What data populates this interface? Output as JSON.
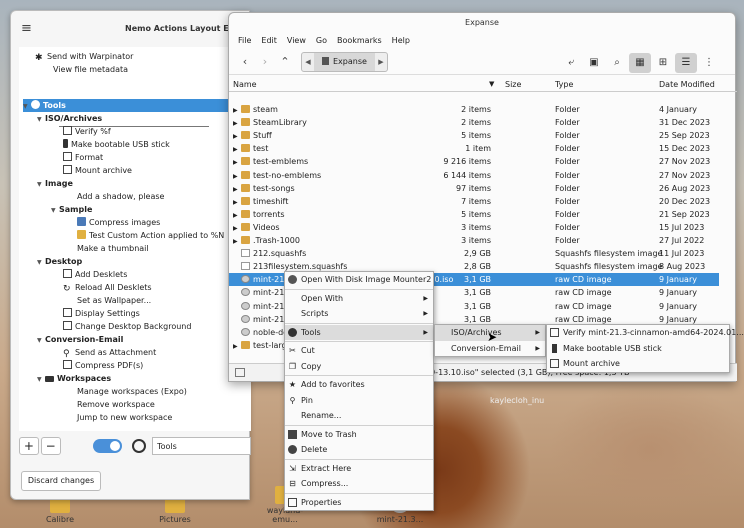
{
  "desktop": {
    "icons": [
      "Calibre",
      "Pictures",
      "wayland-emu...",
      "mint-21.3..."
    ],
    "watermark": "kaylecloh_inu"
  },
  "editor": {
    "title": "Nemo Actions Layout E",
    "items": [
      {
        "label": "Send with Warpinator"
      },
      {
        "label": "View file metadata"
      },
      {
        "label": "Tools"
      },
      {
        "label": "ISO/Archives"
      },
      {
        "label": "Verify %f"
      },
      {
        "label": "Make bootable USB stick"
      },
      {
        "label": "Format"
      },
      {
        "label": "Mount archive"
      },
      {
        "label": "Image"
      },
      {
        "label": "Add a shadow, please"
      },
      {
        "label": "Sample"
      },
      {
        "label": "Compress images"
      },
      {
        "label": "Test Custom Action applied to %N"
      },
      {
        "label": "Make a thumbnail"
      },
      {
        "label": "Desktop"
      },
      {
        "label": "Add Desklets"
      },
      {
        "label": "Reload All Desklets"
      },
      {
        "label": "Set as Wallpaper..."
      },
      {
        "label": "Display Settings"
      },
      {
        "label": "Change Desktop Background"
      },
      {
        "label": "Conversion-Email"
      },
      {
        "label": "Send as Attachment"
      },
      {
        "label": "Compress PDF(s)"
      },
      {
        "label": "Workspaces"
      },
      {
        "label": "Manage workspaces (Expo)"
      },
      {
        "label": "Remove workspace"
      },
      {
        "label": "Jump to new workspace"
      }
    ],
    "add_label": "+",
    "remove_label": "−",
    "name_field_value": "Tools",
    "discard_label": "Discard changes"
  },
  "nemo": {
    "title": "Expanse",
    "menu": [
      "File",
      "Edit",
      "View",
      "Go",
      "Bookmarks",
      "Help"
    ],
    "location": "Expanse",
    "columns": {
      "name": "Name",
      "size": "Size",
      "type": "Type",
      "modified": "Date Modified"
    },
    "files": [
      {
        "name": "steam",
        "size": "2 items",
        "type": "Folder",
        "modified": "4 January",
        "kind": "folder"
      },
      {
        "name": "SteamLibrary",
        "size": "2 items",
        "type": "Folder",
        "modified": "31 Dec 2023",
        "kind": "folder"
      },
      {
        "name": "Stuff",
        "size": "5 items",
        "type": "Folder",
        "modified": "25 Sep 2023",
        "kind": "folder"
      },
      {
        "name": "test",
        "size": "1 item",
        "type": "Folder",
        "modified": "15 Dec 2023",
        "kind": "folder"
      },
      {
        "name": "test-emblems",
        "size": "9 216 items",
        "type": "Folder",
        "modified": "27 Nov 2023",
        "kind": "folder"
      },
      {
        "name": "test-no-emblems",
        "size": "6 144 items",
        "type": "Folder",
        "modified": "27 Nov 2023",
        "kind": "folder"
      },
      {
        "name": "test-songs",
        "size": "97 items",
        "type": "Folder",
        "modified": "26 Aug 2023",
        "kind": "folder"
      },
      {
        "name": "timeshift",
        "size": "7 items",
        "type": "Folder",
        "modified": "20 Dec 2023",
        "kind": "folder"
      },
      {
        "name": "torrents",
        "size": "5 items",
        "type": "Folder",
        "modified": "21 Sep 2023",
        "kind": "folder"
      },
      {
        "name": "Videos",
        "size": "3 items",
        "type": "Folder",
        "modified": "15 Jul 2023",
        "kind": "folder"
      },
      {
        "name": ".Trash-1000",
        "size": "3 items",
        "type": "Folder",
        "modified": "27 Jul 2022",
        "kind": "folder"
      },
      {
        "name": "212.squashfs",
        "size": "2,9 GB",
        "type": "Squashfs filesystem image",
        "modified": "11 Jul 2023",
        "kind": "file"
      },
      {
        "name": "213filesystem.squashfs",
        "size": "2,8 GB",
        "type": "Squashfs filesystem image",
        "modified": "8 Aug 2023",
        "kind": "file"
      },
      {
        "name": "mint-21.3-cinnamon-amd64-2024.01.09-13.10.iso",
        "size": "3,1 GB",
        "type": "raw CD image",
        "modified": "9 January",
        "kind": "iso",
        "selected": true
      },
      {
        "name": "mint-21.3-cinnamon-amd64-2024.01.08.iso",
        "size": "3,1 GB",
        "type": "raw CD image",
        "modified": "9 January",
        "kind": "iso"
      },
      {
        "name": "mint-21.3",
        "size": "3,1 GB",
        "type": "raw CD image",
        "modified": "9 January",
        "kind": "iso"
      },
      {
        "name": "mint-21.3",
        "size": "3,1 GB",
        "type": "raw CD image",
        "modified": "9 January",
        "kind": "iso"
      },
      {
        "name": "noble-de",
        "size": "5,7 GB",
        "type": "raw CD image",
        "modified": "9 January",
        "kind": "iso"
      },
      {
        "name": "test-large",
        "size": "",
        "type": "",
        "modified": "",
        "kind": "folder"
      }
    ],
    "status": "09-13.10.iso\" selected (3,1 GB), Free space: 1,3 TB"
  },
  "context_menu": {
    "items": [
      {
        "label": "Open With Disk Image Mounter2",
        "icon": "disk-icon"
      },
      {
        "label": "Open With",
        "submenu": true
      },
      {
        "label": "Scripts",
        "submenu": true
      },
      {
        "label": "Tools",
        "submenu": true,
        "icon": "tools-icon",
        "highlighted": true
      },
      {
        "label": "Cut",
        "icon": "cut-icon"
      },
      {
        "label": "Copy",
        "icon": "copy-icon"
      },
      {
        "label": "Add to favorites",
        "icon": "star-icon"
      },
      {
        "label": "Pin",
        "icon": "pin-icon"
      },
      {
        "label": "Rename..."
      },
      {
        "label": "Move to Trash",
        "icon": "trash-icon"
      },
      {
        "label": "Delete",
        "icon": "delete-icon"
      },
      {
        "label": "Extract Here",
        "icon": "extract-icon"
      },
      {
        "label": "Compress...",
        "icon": "compress-icon"
      },
      {
        "label": "Properties",
        "icon": "properties-icon"
      }
    ],
    "tools_submenu": [
      {
        "label": "ISO/Archives",
        "submenu": true
      },
      {
        "label": "Conversion-Email",
        "submenu": true
      }
    ],
    "iso_submenu": [
      {
        "label": "Verify mint-21.3-cinnamon-amd64-2024.01...."
      },
      {
        "label": "Make bootable USB stick"
      },
      {
        "label": "Mount archive"
      }
    ]
  }
}
